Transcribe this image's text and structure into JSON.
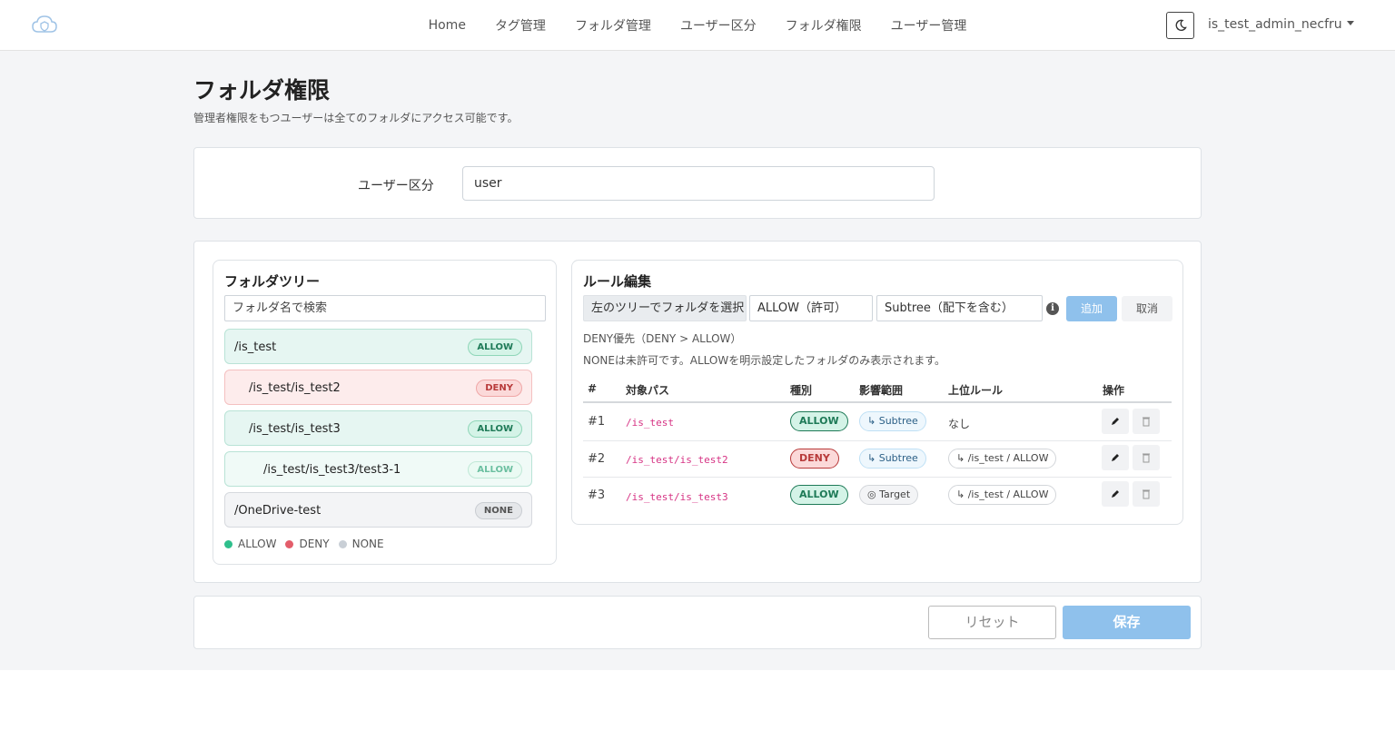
{
  "nav": {
    "links": [
      "Home",
      "タグ管理",
      "フォルダ管理",
      "ユーザー区分",
      "フォルダ権限",
      "ユーザー管理"
    ],
    "user": "is_test_admin_necfru",
    "icons": {
      "logo": "cloud-shield-icon",
      "theme": "moon-icon",
      "caret": "chevron-down-icon"
    }
  },
  "page": {
    "title": "フォルダ権限",
    "subtitle": "管理者権限をもつユーザーは全てのフォルダにアクセス可能です。"
  },
  "user_type": {
    "label": "ユーザー区分",
    "value": "user"
  },
  "tree": {
    "title": "フォルダツリー",
    "search_placeholder": "フォルダ名で検索",
    "nodes": [
      {
        "path": "/is_test",
        "status": "ALLOW"
      },
      {
        "path": "/is_test/is_test2",
        "status": "DENY"
      },
      {
        "path": "/is_test/is_test3",
        "status": "ALLOW"
      },
      {
        "path": "/is_test/is_test3/test3-1",
        "status": "ALLOW"
      },
      {
        "path": "/OneDrive-test",
        "status": "NONE"
      }
    ],
    "legend": [
      "ALLOW",
      "DENY",
      "NONE"
    ],
    "colors": {
      "allow": "#2fbf8c",
      "deny": "#e35d6a",
      "none": "#c9cfd6"
    }
  },
  "rules": {
    "title": "ルール編集",
    "folder_placeholder": "左のツリーでフォルダを選択",
    "type_value": "ALLOW（許可）",
    "scope_value": "Subtree（配下を含む）",
    "add_label": "追加",
    "cancel_label": "取消",
    "note1": "DENY優先（DENY > ALLOW）",
    "note2": "NONEは未許可です。ALLOWを明示設定したフォルダのみ表示されます。",
    "headers": [
      "#",
      "対象パス",
      "種別",
      "影響範囲",
      "上位ルール",
      "操作"
    ],
    "rows": [
      {
        "num": "#1",
        "path": "/is_test",
        "type": "ALLOW",
        "scope": "↳ Subtree",
        "parent": "なし"
      },
      {
        "num": "#2",
        "path": "/is_test/is_test2",
        "type": "DENY",
        "scope": "↳ Subtree",
        "parent": "↳ /is_test / ALLOW"
      },
      {
        "num": "#3",
        "path": "/is_test/is_test3",
        "type": "ALLOW",
        "scope": "◎ Target",
        "parent": "↳ /is_test / ALLOW"
      }
    ]
  },
  "footer": {
    "reset_label": "リセット",
    "save_label": "保存",
    "accent": "#8fc1ec"
  }
}
